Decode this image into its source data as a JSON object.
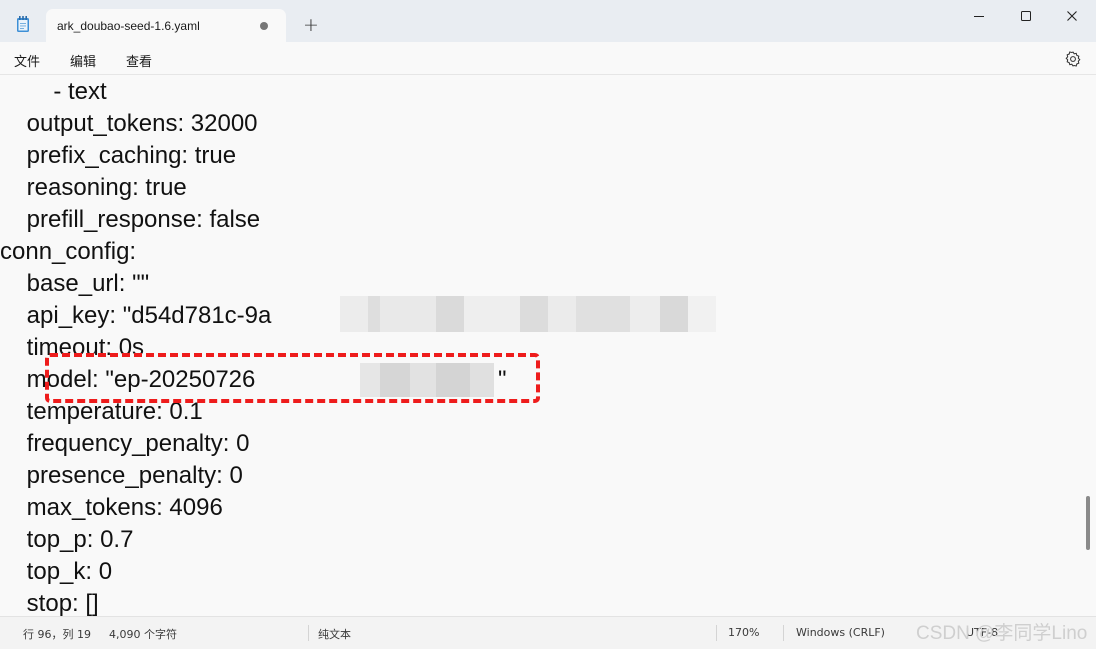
{
  "tab": {
    "title": "ark_doubao-seed-1.6.yaml"
  },
  "new_tab_glyph": "+",
  "menu": {
    "file": "文件",
    "edit": "编辑",
    "view": "查看"
  },
  "code_lines": [
    "        - text",
    "    output_tokens: 32000",
    "    prefix_caching: true",
    "    reasoning: true",
    "    prefill_response: false",
    "conn_config:",
    "    base_url: \"\"",
    "    api_key: \"d54d781c-9a",
    "    timeout: 0s",
    "    model: \"ep-20250726",
    "    temperature: 0.1",
    "    frequency_penalty: 0",
    "    presence_penalty: 0",
    "    max_tokens: 4096",
    "    top_p: 0.7",
    "    top_k: 0",
    "    stop: []"
  ],
  "model_suffix_char": "\"",
  "status": {
    "position": "行 96，列 19",
    "chars": "4,090 个字符",
    "format": "纯文本",
    "zoom": "170%",
    "line_ending": "Windows (CRLF)",
    "encoding": "UTF-8"
  },
  "watermark": "CSDN @李同学Lino",
  "colors": {
    "highlight": "#ee1c1c",
    "titlebar": "#e9edf2",
    "editor_bg": "#f9f9f9"
  },
  "icons": [
    "notepad-icon",
    "minimize-icon",
    "maximize-icon",
    "close-icon",
    "gear-icon",
    "unsaved-dot-icon"
  ]
}
